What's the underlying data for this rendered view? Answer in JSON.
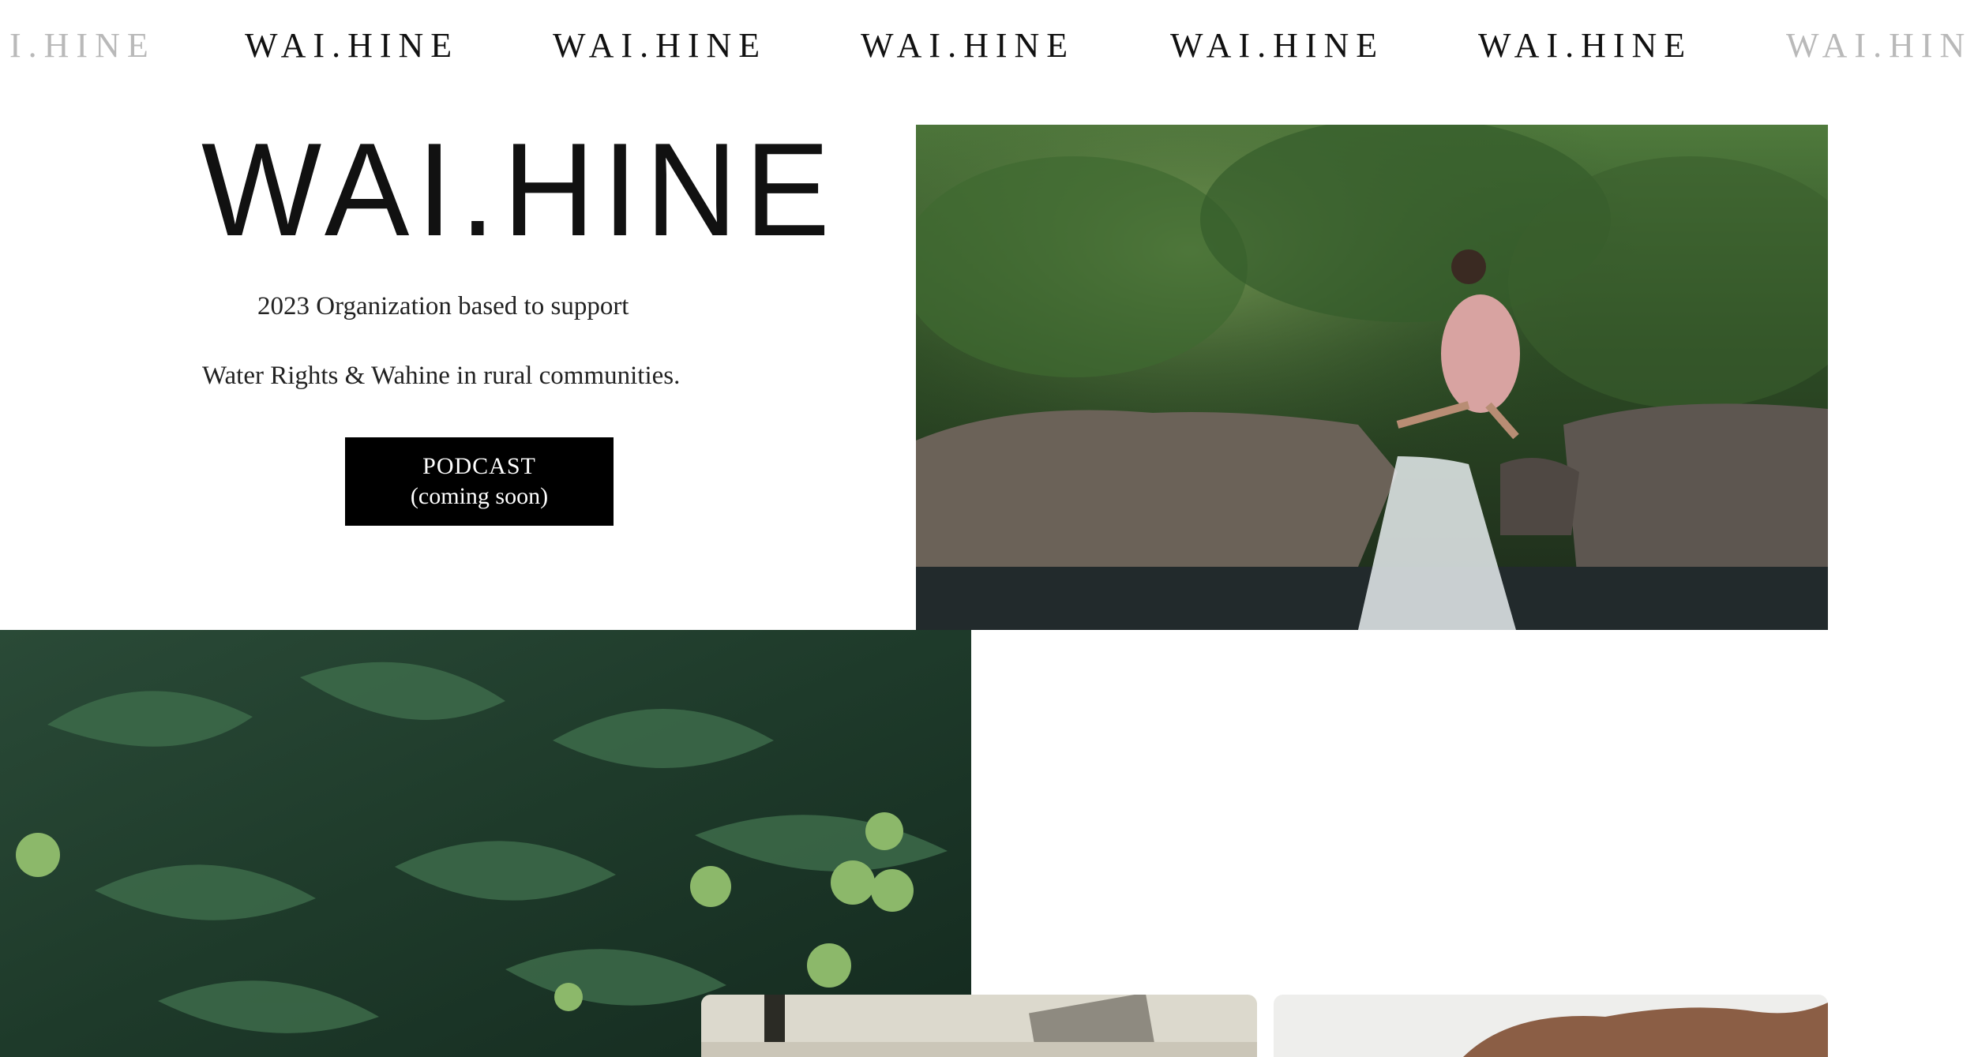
{
  "marquee": {
    "items": [
      "I.HINE",
      "WAI.HINE",
      "WAI.HINE",
      "WAI.HINE",
      "WAI.HINE",
      "WAI.HINE",
      "WAI.HIN"
    ]
  },
  "hero": {
    "logo": "WAI.HINE",
    "tagline_line1": "2023 Organization based to support",
    "tagline_line2": "Water Rights & Wahine in rural communities.",
    "podcast_label": "PODCAST",
    "podcast_sub": "(coming soon)"
  },
  "images": {
    "stream": "woman-crossing-stream-photo",
    "leaves": "breadfruit-tree-photo",
    "notes": "notes-and-photos-photo",
    "hand": "hand-photo"
  },
  "colors": {
    "text": "#111111",
    "button_bg": "#000000",
    "button_text": "#ffffff",
    "faded": "#b9b9b9"
  }
}
